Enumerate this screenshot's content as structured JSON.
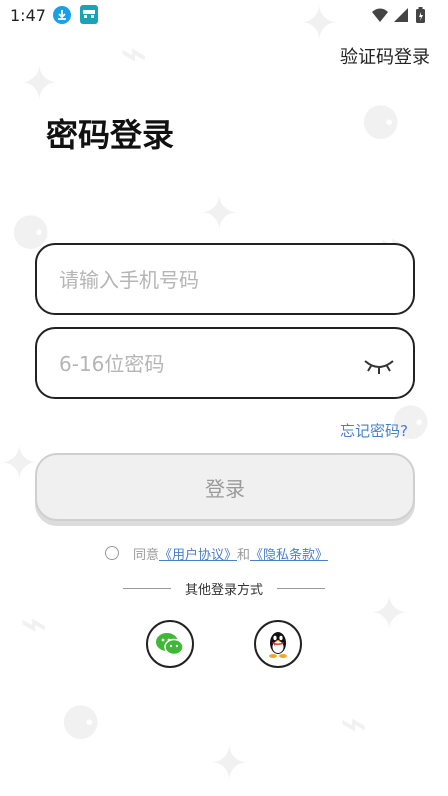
{
  "status_bar": {
    "time": "1:47"
  },
  "header": {
    "sms_login": "验证码登录"
  },
  "page": {
    "title": "密码登录"
  },
  "form": {
    "phone_placeholder": "请输入手机号码",
    "phone_value": "",
    "password_placeholder": "6-16位密码",
    "password_value": "",
    "forgot_password": "忘记密码?",
    "login_button": "登录"
  },
  "agreement": {
    "prefix": "同意",
    "user_agreement": "《用户协议》",
    "and": "和",
    "privacy_policy": "《隐私条款》"
  },
  "other_login": {
    "label": "其他登录方式",
    "methods": [
      "wechat-icon",
      "qq-icon"
    ]
  },
  "colors": {
    "link": "#4a7fc9",
    "border": "#222222",
    "button_bg": "#f0f0f0",
    "wechat": "#3fb837"
  }
}
